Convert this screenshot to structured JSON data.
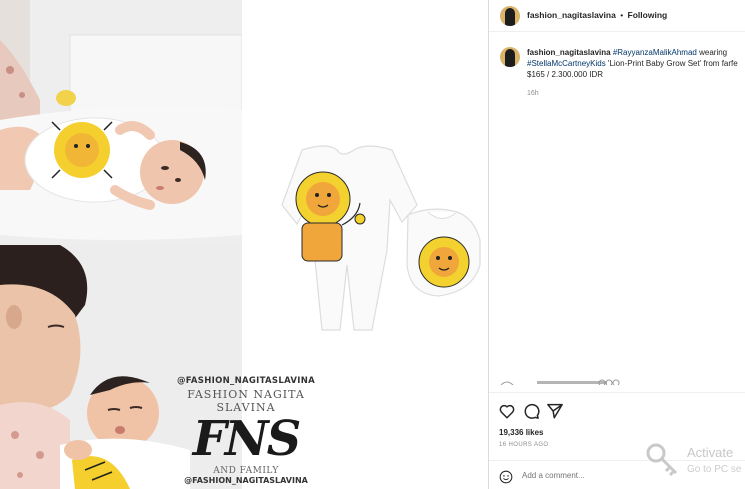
{
  "post": {
    "username": "fashion_nagitaslavina",
    "separator": "•",
    "follow_status": "Following"
  },
  "caption": {
    "username": "fashion_nagitaslavina",
    "hashtag1": "#RayyanzaMalikAhmad",
    "text1": " wearing",
    "hashtag2": "#StellaMcCartneyKids",
    "text2": " 'Lion-Print Baby Grow Set' from farfe",
    "price": "$165 / 2.300.000 IDR",
    "time": "16h"
  },
  "watermark": {
    "handle_top": "@FASHION_NAGITASLAVINA",
    "title": "FASHION NAGITA SLAVINA",
    "logo": "FNS",
    "family": "AND FAMILY",
    "handle_bottom": "@FASHION_NAGITASLAVINA"
  },
  "stats": {
    "likes": "19,336 likes",
    "time_ago": "16 HOURS AGO"
  },
  "comment": {
    "placeholder": "Add a comment..."
  },
  "activation": {
    "title": "Activate",
    "subtitle": "Go to PC se"
  },
  "icons": {
    "like": "heart-icon",
    "comment": "comment-icon",
    "share": "send-icon",
    "emoji": "emoji-icon",
    "key": "key-icon"
  },
  "colors": {
    "hashtag": "#00376b",
    "muted": "#8e8e8e",
    "border": "#efefef",
    "text": "#262626"
  }
}
